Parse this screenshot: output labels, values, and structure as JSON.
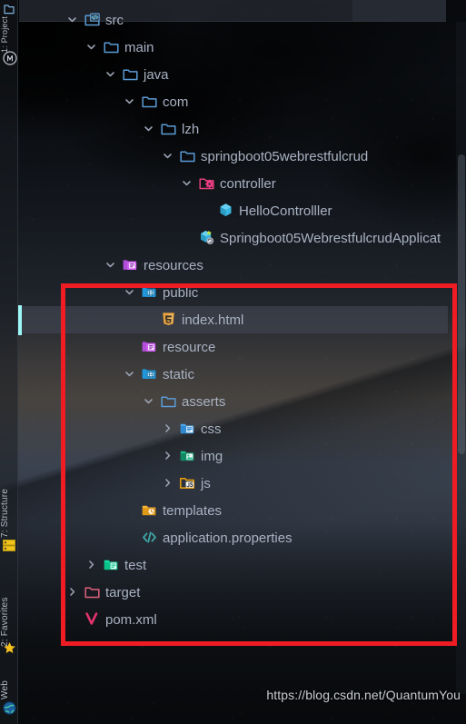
{
  "window": {
    "app": "IntelliJ IDEA Project Tool Window",
    "watermark": "https://blog.csdn.net/QuantumYou"
  },
  "tool_stripe": {
    "top_items": [
      {
        "label": "1: Project",
        "icon": "project-icon"
      },
      {
        "label": "",
        "icon": "maven-icon"
      }
    ],
    "bottom_items": [
      {
        "label": "7: Structure",
        "icon": "structure-icon"
      },
      {
        "label": "2: Favorites",
        "icon": "star-icon"
      },
      {
        "label": "Web",
        "icon": "globe-icon"
      }
    ]
  },
  "colors": {
    "annotation_red": "#ef1c24",
    "selection": "#42475470",
    "vcs_modified": "#9ef7f7",
    "text": "#a9b2c3",
    "folder_blue": "#5b9bd5",
    "folder_purple": "#b14fd8",
    "folder_cyan": "#2196d8",
    "folder_green": "#16a47a",
    "folder_orange": "#f0a30a",
    "folder_pink": "#e2417a",
    "folder_teal": "#0fd8a0",
    "html_orange": "#e8a33d",
    "props_teal": "#3ea6a6",
    "maven_pink": "#e2336b"
  },
  "tree": {
    "rows": [
      {
        "name": "src",
        "indent": 0,
        "arrow": "down",
        "icon": "src-folder-icon",
        "icon_color": "#5b9bd5",
        "selected": false
      },
      {
        "name": "main",
        "indent": 1,
        "arrow": "down",
        "icon": "folder-icon",
        "icon_color": "#5b9bd5",
        "selected": false
      },
      {
        "name": "java",
        "indent": 2,
        "arrow": "down",
        "icon": "folder-icon",
        "icon_color": "#5b9bd5",
        "selected": false
      },
      {
        "name": "com",
        "indent": 3,
        "arrow": "down",
        "icon": "folder-icon",
        "icon_color": "#5b9bd5",
        "selected": false
      },
      {
        "name": "lzh",
        "indent": 4,
        "arrow": "down",
        "icon": "folder-icon",
        "icon_color": "#5b9bd5",
        "selected": false
      },
      {
        "name": "springboot05webrestfulcrud",
        "indent": 5,
        "arrow": "down",
        "icon": "folder-icon",
        "icon_color": "#5b9bd5",
        "selected": false
      },
      {
        "name": "controller",
        "indent": 6,
        "arrow": "down",
        "icon": "package-controller-icon",
        "icon_color": "#e2417a",
        "selected": false
      },
      {
        "name": "HelloControlller",
        "indent": 7,
        "arrow": "none",
        "icon": "java-class-icon",
        "icon_color": "#39b6e0",
        "selected": false
      },
      {
        "name": "Springboot05WebrestfulcrudApplicat",
        "indent": 6,
        "arrow": "none",
        "icon": "spring-boot-class-icon",
        "icon_color": "#39b6e0",
        "selected": false
      },
      {
        "name": "resources",
        "indent": 2,
        "arrow": "down",
        "icon": "resources-folder-icon",
        "icon_color": "#b14fd8",
        "selected": false
      },
      {
        "name": "public",
        "indent": 3,
        "arrow": "down",
        "icon": "web-folder-icon",
        "icon_color": "#2196d8",
        "selected": false
      },
      {
        "name": "index.html",
        "indent": 4,
        "arrow": "none",
        "icon": "html5-icon",
        "icon_color": "#e8a33d",
        "selected": true
      },
      {
        "name": "resource",
        "indent": 3,
        "arrow": "none",
        "icon": "resources-folder-icon",
        "icon_color": "#b14fd8",
        "selected": false
      },
      {
        "name": "static",
        "indent": 3,
        "arrow": "down",
        "icon": "web-folder-icon",
        "icon_color": "#2196d8",
        "selected": false
      },
      {
        "name": "asserts",
        "indent": 4,
        "arrow": "down",
        "icon": "folder-icon",
        "icon_color": "#5b9bd5",
        "selected": false
      },
      {
        "name": "css",
        "indent": 5,
        "arrow": "right",
        "icon": "css-folder-icon",
        "icon_color": "#3a92d4",
        "selected": false
      },
      {
        "name": "img",
        "indent": 5,
        "arrow": "right",
        "icon": "img-folder-icon",
        "icon_color": "#16a47a",
        "selected": false
      },
      {
        "name": "js",
        "indent": 5,
        "arrow": "right",
        "icon": "js-folder-icon",
        "icon_color": "#f0a30a",
        "selected": false
      },
      {
        "name": "templates",
        "indent": 3,
        "arrow": "none",
        "icon": "templates-folder-icon",
        "icon_color": "#f0a30a",
        "selected": false
      },
      {
        "name": "application.properties",
        "indent": 3,
        "arrow": "none",
        "icon": "properties-icon",
        "icon_color": "#3ea6a6",
        "selected": false
      },
      {
        "name": "test",
        "indent": 1,
        "arrow": "right",
        "icon": "test-folder-icon",
        "icon_color": "#0fd8a0",
        "selected": false
      },
      {
        "name": "target",
        "indent": 0,
        "arrow": "right",
        "icon": "folder-icon",
        "icon_color": "#e0607e",
        "selected": false
      },
      {
        "name": "pom.xml",
        "indent": 0,
        "arrow": "none",
        "icon": "maven-pom-icon",
        "icon_color": "#e2336b",
        "selected": false
      }
    ]
  },
  "annotation": {
    "shape": "rectangle",
    "color": "#ef1c24",
    "encloses": "resources subtree from 'resources' through 'application.properties'"
  }
}
